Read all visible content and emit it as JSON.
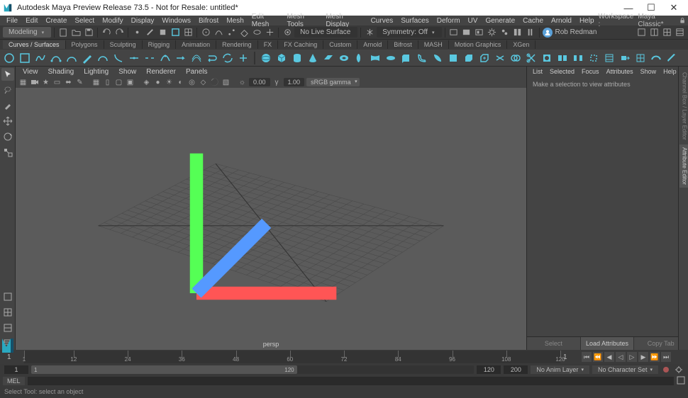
{
  "title": "Autodesk Maya Preview Release 73.5 - Not for Resale: untitled*",
  "workspace_label": "Workspace :",
  "workspace_value": "Maya Classic*",
  "menubar": [
    "File",
    "Edit",
    "Create",
    "Select",
    "Modify",
    "Display",
    "Windows",
    "Bifrost",
    "Mesh",
    "Edit Mesh",
    "Mesh Tools",
    "Mesh Display",
    "Curves",
    "Surfaces",
    "Deform",
    "UV",
    "Generate",
    "Cache",
    "Arnold",
    "Help"
  ],
  "status": {
    "mode": "Modeling",
    "surface": "No Live Surface",
    "symmetry": "Symmetry: Off",
    "user": "Rob Redman"
  },
  "shelf_tabs": [
    "Curves / Surfaces",
    "Polygons",
    "Sculpting",
    "Rigging",
    "Animation",
    "Rendering",
    "FX",
    "FX Caching",
    "Custom",
    "Arnold",
    "Bifrost",
    "MASH",
    "Motion Graphics",
    "XGen"
  ],
  "viewport": {
    "menu": [
      "View",
      "Shading",
      "Lighting",
      "Show",
      "Renderer",
      "Panels"
    ],
    "num1": "0.00",
    "num2": "1.00",
    "gamma": "sRGB gamma",
    "camera": "persp"
  },
  "attr": {
    "menu": [
      "List",
      "Selected",
      "Focus",
      "Attributes",
      "Show",
      "Help"
    ],
    "empty": "Make a selection to view attributes",
    "btns": [
      "Select",
      "Load Attributes",
      "Copy Tab"
    ]
  },
  "right_tabs": [
    "Channel Box / Layer Editor",
    "Attribute Editor"
  ],
  "time": {
    "start": "1",
    "cur": "1",
    "rmin": "1",
    "rmax": "120",
    "end": "120",
    "end2": "200",
    "anim": "No Anim Layer",
    "char": "No Character Set",
    "ticks": [
      1,
      12,
      24,
      36,
      48,
      60,
      72,
      84,
      96,
      108,
      120
    ]
  },
  "cmd": {
    "lang": "MEL"
  },
  "help": "Select Tool: select an object"
}
